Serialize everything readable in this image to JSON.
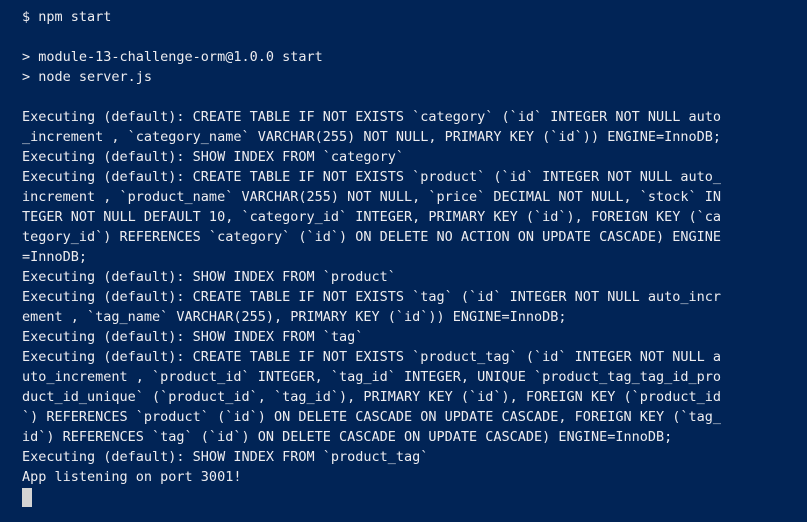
{
  "terminal": {
    "prompt_line": "$ npm start",
    "npm_banner": [
      "> module-13-challenge-orm@1.0.0 start",
      "> node server.js"
    ],
    "output": [
      "Executing (default): CREATE TABLE IF NOT EXISTS `category` (`id` INTEGER NOT NULL auto",
      "_increment , `category_name` VARCHAR(255) NOT NULL, PRIMARY KEY (`id`)) ENGINE=InnoDB;",
      "Executing (default): SHOW INDEX FROM `category`",
      "Executing (default): CREATE TABLE IF NOT EXISTS `product` (`id` INTEGER NOT NULL auto_",
      "increment , `product_name` VARCHAR(255) NOT NULL, `price` DECIMAL NOT NULL, `stock` IN",
      "TEGER NOT NULL DEFAULT 10, `category_id` INTEGER, PRIMARY KEY (`id`), FOREIGN KEY (`ca",
      "tegory_id`) REFERENCES `category` (`id`) ON DELETE NO ACTION ON UPDATE CASCADE) ENGINE",
      "=InnoDB;",
      "Executing (default): SHOW INDEX FROM `product`",
      "Executing (default): CREATE TABLE IF NOT EXISTS `tag` (`id` INTEGER NOT NULL auto_incr",
      "ement , `tag_name` VARCHAR(255), PRIMARY KEY (`id`)) ENGINE=InnoDB;",
      "Executing (default): SHOW INDEX FROM `tag`",
      "Executing (default): CREATE TABLE IF NOT EXISTS `product_tag` (`id` INTEGER NOT NULL a",
      "uto_increment , `product_id` INTEGER, `tag_id` INTEGER, UNIQUE `product_tag_tag_id_pro",
      "duct_id_unique` (`product_id`, `tag_id`), PRIMARY KEY (`id`), FOREIGN KEY (`product_id",
      "`) REFERENCES `product` (`id`) ON DELETE CASCADE ON UPDATE CASCADE, FOREIGN KEY (`tag_",
      "id`) REFERENCES `tag` (`id`) ON DELETE CASCADE ON UPDATE CASCADE) ENGINE=InnoDB;",
      "Executing (default): SHOW INDEX FROM `product_tag`",
      "App listening on port 3001!"
    ],
    "colors": {
      "background": "#012456",
      "foreground": "#eeedf0",
      "cursor": "#d4d4d4"
    }
  }
}
